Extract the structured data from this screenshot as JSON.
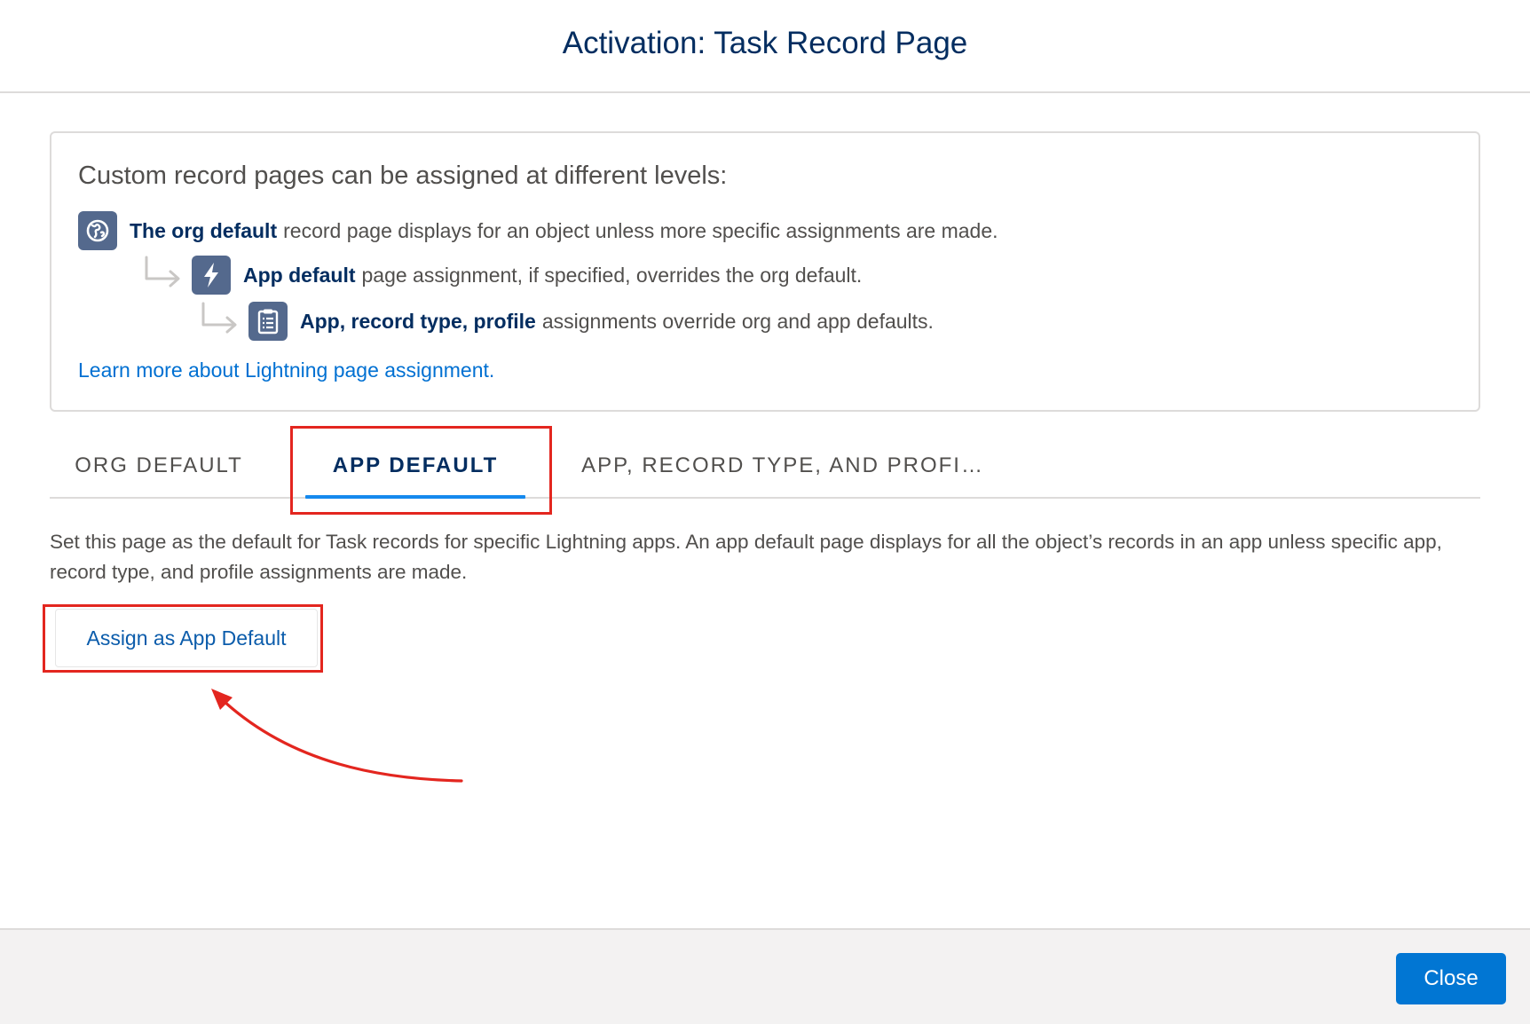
{
  "modal": {
    "title": "Activation: Task Record Page"
  },
  "info": {
    "heading": "Custom record pages can be assigned at different levels:",
    "levels": [
      {
        "icon": "globe-icon",
        "bold": "The org default",
        "text": "record page displays for an object unless more specific assignments are made."
      },
      {
        "icon": "lightning-bolt-icon",
        "bold": "App default",
        "text": "page assignment, if specified, overrides the org default."
      },
      {
        "icon": "clipboard-icon",
        "bold": "App, record type, profile",
        "text": "assignments override org and app defaults."
      }
    ],
    "learn_more_link": "Learn more about Lightning page assignment."
  },
  "tabs": [
    {
      "label": "ORG DEFAULT",
      "active": false
    },
    {
      "label": "APP DEFAULT",
      "active": true
    },
    {
      "label": "APP, RECORD TYPE, AND PROFI…",
      "active": false
    }
  ],
  "tab_panel": {
    "description": "Set this page as the default for Task records for specific Lightning apps. An app default page displays for all the object’s records in an app unless specific app, record type, and profile assignments are made.",
    "assign_button_label": "Assign as App Default"
  },
  "footer": {
    "close_label": "Close"
  },
  "colors": {
    "title": "#032d60",
    "link": "#0070d2",
    "active_tab_indicator": "#1589ee",
    "primary_button": "#0176d3",
    "icon_badge": "#54698d",
    "annotation_red": "#e3261f"
  }
}
